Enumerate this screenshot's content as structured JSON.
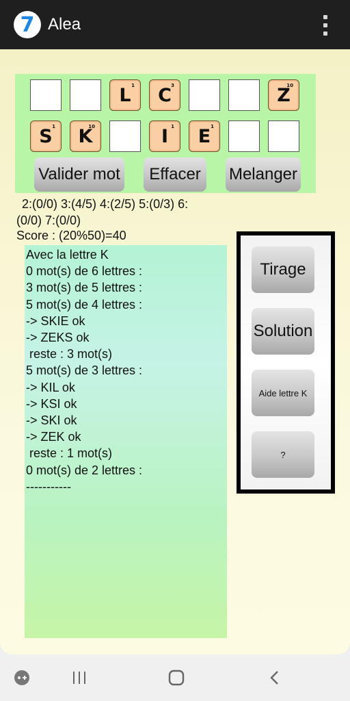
{
  "app": {
    "title": "Alea",
    "logo_text": "7",
    "menu_icon": "more-vertical-icon"
  },
  "board": {
    "row1": [
      {
        "letter": "",
        "points": ""
      },
      {
        "letter": "",
        "points": ""
      },
      {
        "letter": "L",
        "points": "1"
      },
      {
        "letter": "C",
        "points": "3"
      },
      {
        "letter": "",
        "points": ""
      },
      {
        "letter": "",
        "points": ""
      },
      {
        "letter": "Z",
        "points": "10"
      }
    ],
    "row2": [
      {
        "letter": "S",
        "points": "1"
      },
      {
        "letter": "K",
        "points": "10"
      },
      {
        "letter": "",
        "points": ""
      },
      {
        "letter": "I",
        "points": "1"
      },
      {
        "letter": "E",
        "points": "1"
      },
      {
        "letter": "",
        "points": ""
      },
      {
        "letter": "",
        "points": ""
      }
    ],
    "buttons": {
      "validate": "Valider mot",
      "erase": "Effacer",
      "shuffle": "Melanger"
    }
  },
  "stats": {
    "line1": "2:(0/0)  3:(4/5)  4:(2/5)  5:(0/3)  6:",
    "line2": "(0/0)  7:(0/0)"
  },
  "score": "Score : (20%50)=40",
  "log_lines": [
    "Avec la lettre K",
    "0 mot(s) de 6 lettres :",
    "3 mot(s) de 5 lettres :",
    "5 mot(s) de 4 lettres :",
    "-> SKIE ok",
    "-> ZEKS ok",
    " reste : 3 mot(s)",
    "5 mot(s) de 3 lettres :",
    "-> KIL ok",
    "-> KSI ok",
    "-> SKI ok",
    "-> ZEK ok",
    " reste : 1 mot(s)",
    "0 mot(s) de 2 lettres :",
    "-----------"
  ],
  "side_buttons": {
    "draw": "Tirage",
    "solution": "Solution",
    "hint": "Aide lettre K",
    "help": "?"
  },
  "nav": {
    "assistant_icon": "game-launcher-icon",
    "recents_icon": "recents-icon",
    "home_icon": "home-icon",
    "back_icon": "back-icon"
  },
  "colors": {
    "app_bar": "#1f1f1f",
    "board_bg": "#b9f5a7",
    "tile": "#f9cfa3",
    "log_bg": "#b4f3d4"
  }
}
